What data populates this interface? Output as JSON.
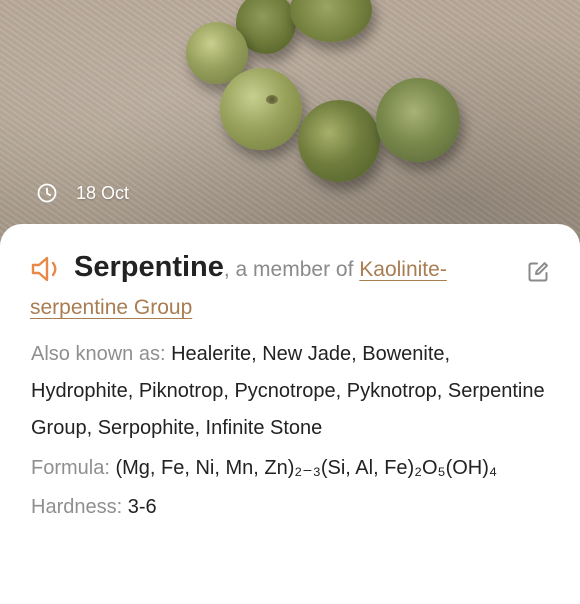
{
  "photo": {
    "subject": "green serpentine beads on beige carpet",
    "date": "18 Oct",
    "date_icon": "clock-icon"
  },
  "mineral": {
    "name": "Serpentine",
    "member_text": ", a member of ",
    "group_link_line1": "Kaolinite-",
    "group_link_line2": "serpentine Group",
    "audio_icon": "speaker-icon",
    "edit_icon": "edit-icon"
  },
  "properties": {
    "aka_label": "Also known as: ",
    "aka_value": "Healerite, New Jade, Bowenite, Hydrophite, Piknotrop, Pycnotrope, Pyknotrop, Serpentine Group, Serpophite, Infinite Stone",
    "formula_label": "Formula: ",
    "formula_value": "(Mg, Fe, Ni, Mn, Zn)₂₋₃(Si, Al, Fe)₂O₅(OH)₄",
    "hardness_label": "Hardness: ",
    "hardness_value": "3-6"
  },
  "colors": {
    "accent": "#a87d52",
    "speaker": "#e8894a",
    "label": "#8f8f8f",
    "text": "#222222"
  }
}
